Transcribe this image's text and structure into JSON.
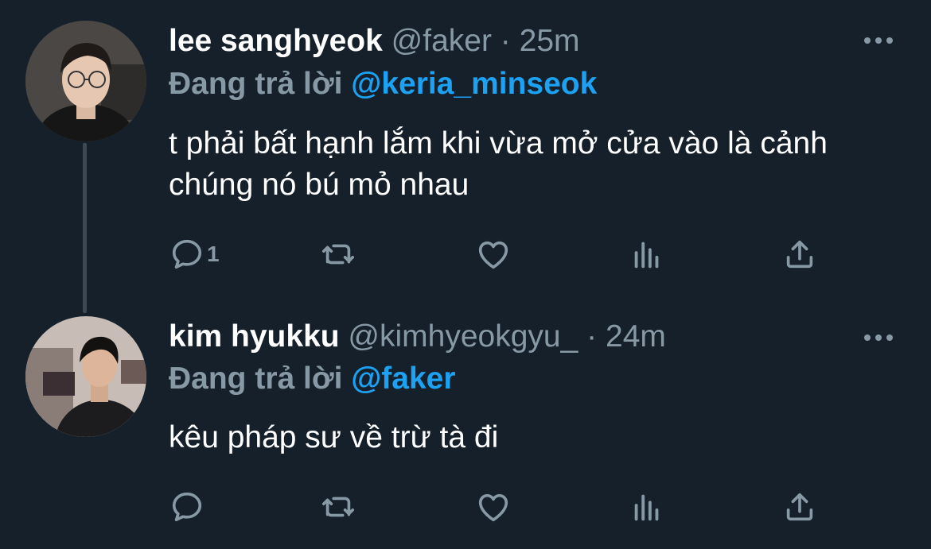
{
  "tweets": [
    {
      "name": "lee sanghyeok",
      "handle": "@faker",
      "separator": "·",
      "time": "25m",
      "replying_label": "Đang trả lời",
      "replying_to": "@keria_minseok",
      "text": "t phải bất hạnh lắm khi vừa mở cửa vào là cảnh chúng nó bú mỏ nhau",
      "reply_count": "1"
    },
    {
      "name": "kim hyukku",
      "handle": "@kimhyeokgyu_",
      "separator": "·",
      "time": "24m",
      "replying_label": "Đang trả lời",
      "replying_to": "@faker",
      "text": "kêu pháp sư về trừ tà đi",
      "reply_count": ""
    }
  ],
  "icons": [
    "reply-icon",
    "retweet-icon",
    "like-icon",
    "analytics-icon",
    "share-icon",
    "more-icon"
  ],
  "colors": {
    "background": "#15202b",
    "muted": "#8899a6",
    "link": "#1da1f2",
    "text": "#ffffff"
  }
}
